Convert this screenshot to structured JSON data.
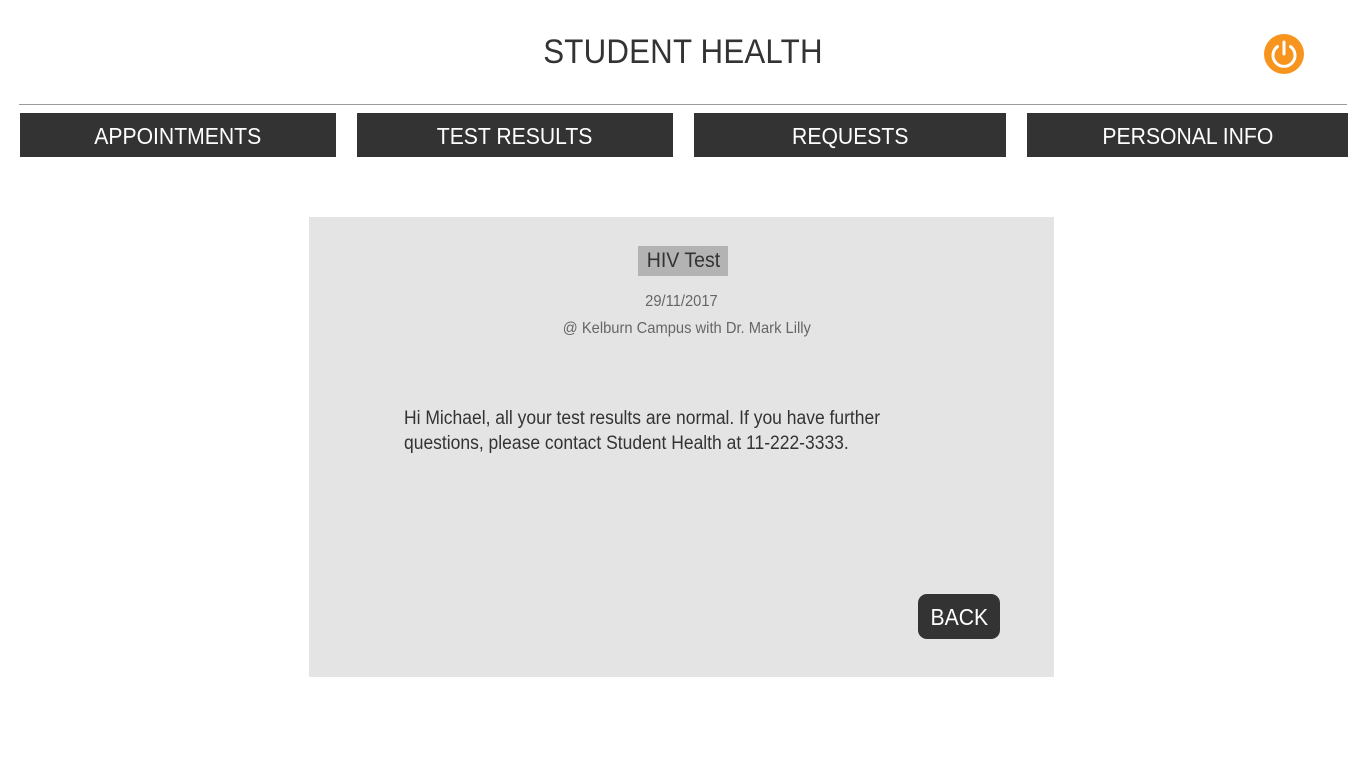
{
  "header": {
    "title": "STUDENT HEALTH",
    "power_icon": "power-icon",
    "power_color": "#f7941d"
  },
  "nav": {
    "tabs": [
      {
        "label": "APPOINTMENTS"
      },
      {
        "label": "TEST RESULTS"
      },
      {
        "label": "REQUESTS"
      },
      {
        "label": "PERSONAL INFO"
      }
    ]
  },
  "result": {
    "test_name": "HIV Test",
    "date": "29/11/2017",
    "location": "@ Kelburn Campus with Dr. Mark Lilly",
    "message": "Hi Michael, all your test results are normal. If you have further questions, please contact Student Health at 11-222-3333.",
    "back_label": "BACK"
  },
  "colors": {
    "accent": "#f7941d",
    "dark": "#333333",
    "panel": "#e4e4e4",
    "highlight": "#b3b3b3"
  }
}
